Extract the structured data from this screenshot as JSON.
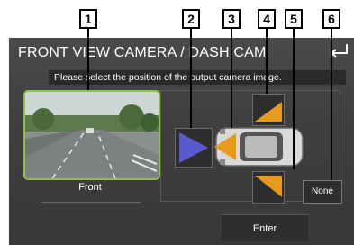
{
  "header": {
    "title": "FRONT VIEW CAMERA / DASH CAM"
  },
  "hint": "Please select the position of the output camera image.",
  "front_option": {
    "label": "Front"
  },
  "buttons": {
    "none_label": "None",
    "enter_label": "Enter"
  },
  "callouts": [
    "1",
    "2",
    "3",
    "4",
    "5",
    "6"
  ],
  "colors": {
    "front_border": "#8cc63f",
    "cam_blue": "#5a5ad0",
    "cam_orange": "#e89a1c",
    "screen_bg": "#424242"
  },
  "icons": {
    "back": "back-arrow-icon",
    "car": "car-top-view-icon"
  }
}
